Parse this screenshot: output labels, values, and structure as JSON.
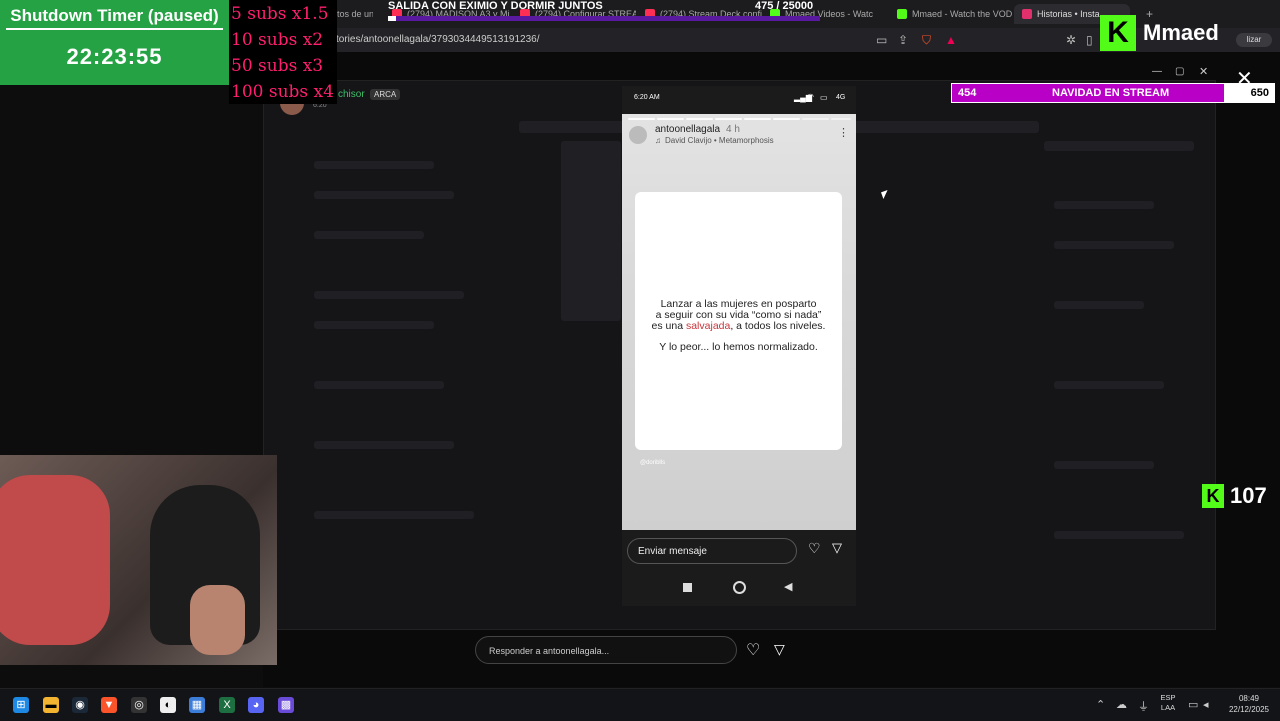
{
  "browser": {
    "tabs": [
      {
        "label": "tos de un",
        "color": "#888888"
      },
      {
        "label": "(2794) MADISON A3 y Mi",
        "color": "#ff2e54"
      },
      {
        "label": "(2794) Configurar STREAM",
        "color": "#ff2e54"
      },
      {
        "label": "(2794) Stream Deck confi",
        "color": "#ff2e54"
      },
      {
        "label": "Mmaed Videos - Watc",
        "color": "#53fc18"
      },
      {
        "label": "Mmaed - Watch the VOD",
        "color": "#53fc18"
      },
      {
        "label": "Historias • Insta",
        "color": "#e1306c"
      }
    ],
    "url": "tories/antoonellagala/3793034449513191236/",
    "extra_button": "lizar"
  },
  "discord_bg": {
    "username": "chisor",
    "tag": "ARCA",
    "time": "6:20"
  },
  "story": {
    "phone_time": "6:20 AM",
    "phone_status": "4G",
    "account": "antoonellagala",
    "age": "4 h",
    "music": "David Clavijo • Metamorphosis",
    "quote_line1": "Lanzar a las mujeres en posparto",
    "quote_line2": "a seguir con su vida “como si nada”",
    "quote_line3_a": "es una ",
    "quote_line3_highlight": "salvajada",
    "quote_line3_b": ", a todos los niveles.",
    "quote_line4": "Y lo peor... lo hemos normalizado.",
    "watermark": "@doriblls",
    "message_placeholder": "Enviar mensaje"
  },
  "reply": {
    "placeholder": "Responder a antoonellagala..."
  },
  "overlay": {
    "timer_title": "Shutdown Timer (paused)",
    "timer_time": "22:23:55",
    "subs": [
      "5 subs x1.5",
      "10 subs x2",
      "50 subs x3",
      "100 subs x4"
    ],
    "goal_title": "SALIDA CON EXIMIO Y DORMIR JUNTOS",
    "goal_count": "475 / 25000",
    "goal_progress": 0.019,
    "channel_name": "Mmaed",
    "christmas_left": "454",
    "christmas_title": "NAVIDAD EN STREAM",
    "christmas_right": "650",
    "viewers": "107",
    "brand_color": "#53fc18"
  },
  "taskbar": {
    "lang_top": "ESP",
    "lang_bottom": "LAA",
    "time": "08:49",
    "date": "22/12/2025"
  }
}
